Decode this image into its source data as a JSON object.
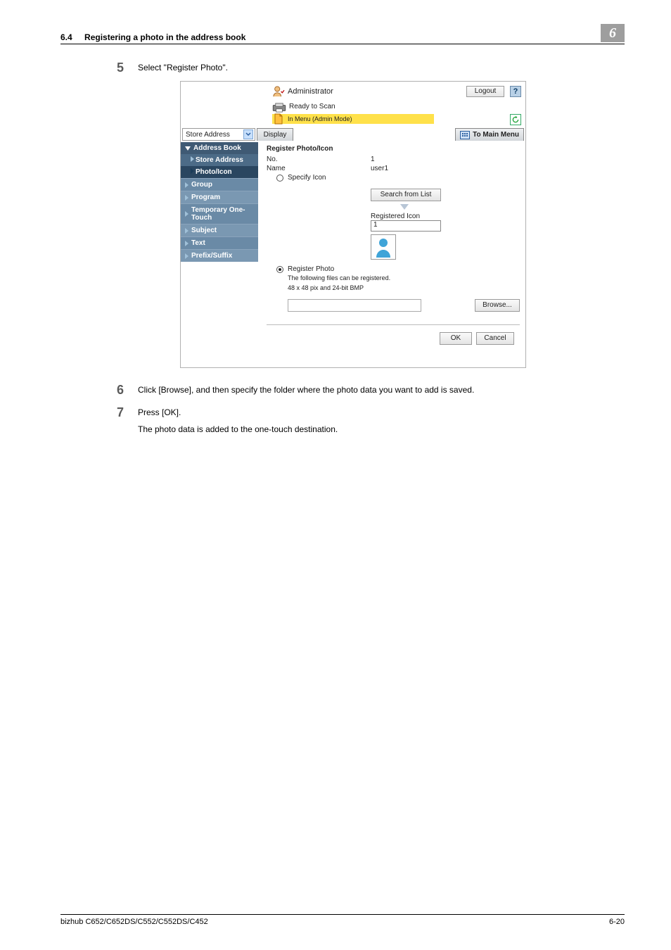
{
  "header": {
    "section_number": "6.4",
    "section_title": "Registering a photo in the address book",
    "chapter": "6"
  },
  "steps": {
    "s5": {
      "num": "5",
      "text": "Select \"Register Photo\"."
    },
    "s6": {
      "num": "6",
      "text": "Click [Browse], and then specify the folder where the photo data you want to add is saved."
    },
    "s7": {
      "num": "7",
      "text": "Press [OK].",
      "sub": "The photo data is added to the one-touch destination."
    }
  },
  "shot": {
    "admin": "Administrator",
    "logout": "Logout",
    "help": "?",
    "ready": "Ready to Scan",
    "mode": "In Menu (Admin Mode)",
    "dropdown": "Store Address",
    "display_tab": "Display",
    "mainmenu_tab": "To Main Menu",
    "sidebar": {
      "address_book": "Address Book",
      "store_address": "Store Address",
      "photo_icon": "Photo/Icon",
      "group": "Group",
      "program": "Program",
      "temporary": "Temporary One-Touch",
      "subject": "Subject",
      "text": "Text",
      "prefix": "Prefix/Suffix"
    },
    "content": {
      "title": "Register Photo/Icon",
      "no_label": "No.",
      "no_value": "1",
      "name_label": "Name",
      "name_value": "user1",
      "opt_specify": "Specify Icon",
      "search_btn": "Search from List",
      "registered_icon": "Registered Icon",
      "reg_value": "1",
      "opt_register": "Register Photo",
      "filespec1": "The following files can be registered.",
      "filespec2": "48 x 48 pix and 24-bit BMP",
      "browse": "Browse...",
      "ok": "OK",
      "cancel": "Cancel"
    }
  },
  "footer": {
    "model": "bizhub C652/C652DS/C552/C552DS/C452",
    "page": "6-20"
  }
}
